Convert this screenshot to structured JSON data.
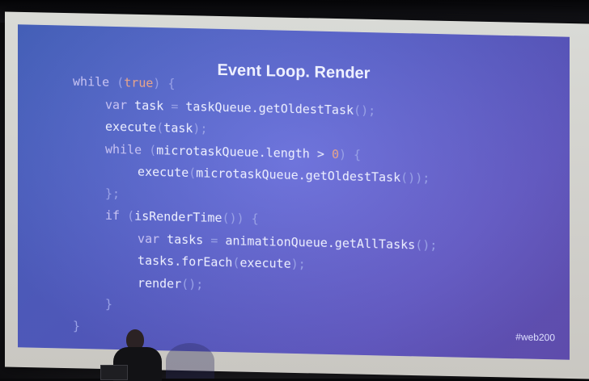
{
  "slide": {
    "title": "Event Loop. Render",
    "hashtag": "#web200",
    "code_lines": [
      {
        "indent": 0,
        "parts": [
          [
            "kw",
            "while "
          ],
          [
            "punct",
            "("
          ],
          [
            "lit",
            "true"
          ],
          [
            "punct",
            ") {"
          ]
        ]
      },
      {
        "indent": 1,
        "parts": [
          [
            "kw",
            "var "
          ],
          [
            "",
            "task "
          ],
          [
            "punct",
            "= "
          ],
          [
            "",
            "taskQueue.getOldestTask"
          ],
          [
            "punct",
            "();"
          ]
        ]
      },
      {
        "indent": 1,
        "parts": [
          [
            "",
            "execute"
          ],
          [
            "punct",
            "("
          ],
          [
            "",
            "task"
          ],
          [
            "punct",
            ");"
          ]
        ]
      },
      {
        "indent": 1,
        "parts": [
          [
            "kw",
            "while "
          ],
          [
            "punct",
            "("
          ],
          [
            "",
            "microtaskQueue.length > "
          ],
          [
            "lit",
            "0"
          ],
          [
            "punct",
            ") {"
          ]
        ]
      },
      {
        "indent": 2,
        "parts": [
          [
            "",
            "execute"
          ],
          [
            "punct",
            "("
          ],
          [
            "",
            "microtaskQueue.getOldestTask"
          ],
          [
            "punct",
            "());"
          ]
        ]
      },
      {
        "indent": 1,
        "parts": [
          [
            "punct",
            "};"
          ]
        ]
      },
      {
        "indent": 1,
        "parts": [
          [
            "kw",
            "if "
          ],
          [
            "punct",
            "("
          ],
          [
            "",
            "isRenderTime"
          ],
          [
            "punct",
            "()) {"
          ]
        ]
      },
      {
        "indent": 2,
        "parts": [
          [
            "kw",
            "var "
          ],
          [
            "",
            "tasks "
          ],
          [
            "punct",
            "= "
          ],
          [
            "",
            "animationQueue.getAllTasks"
          ],
          [
            "punct",
            "();"
          ]
        ]
      },
      {
        "indent": 2,
        "parts": [
          [
            "",
            "tasks.forEach"
          ],
          [
            "punct",
            "("
          ],
          [
            "",
            "execute"
          ],
          [
            "punct",
            ");"
          ]
        ]
      },
      {
        "indent": 2,
        "parts": [
          [
            "",
            "render"
          ],
          [
            "punct",
            "();"
          ]
        ]
      },
      {
        "indent": 1,
        "parts": [
          [
            "punct",
            "}"
          ]
        ]
      },
      {
        "indent": 0,
        "parts": [
          [
            "punct",
            "}"
          ]
        ]
      }
    ]
  }
}
